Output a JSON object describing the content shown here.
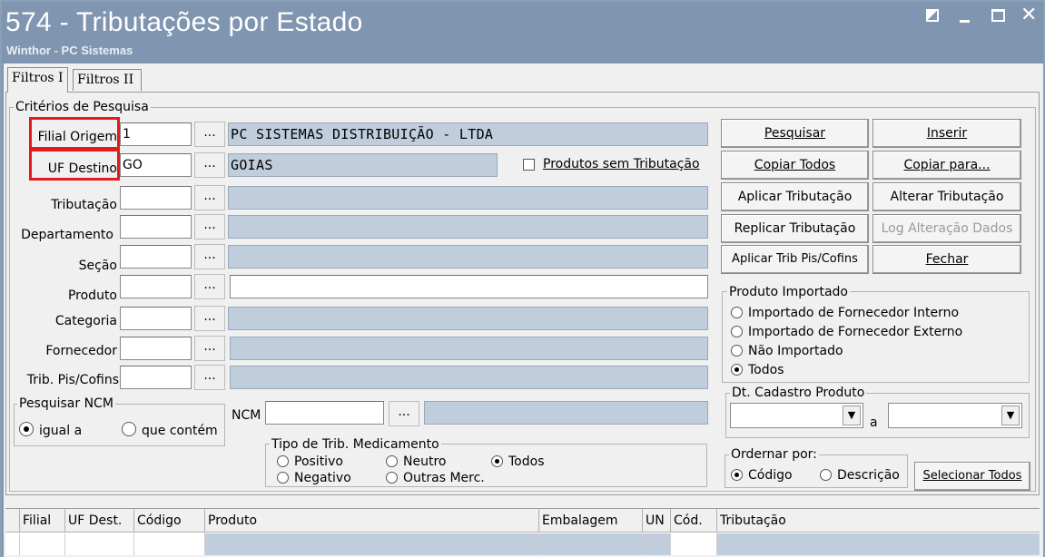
{
  "window": {
    "title": "574 - Tributações por Estado",
    "subtitle": "Winthor - PC Sistemas"
  },
  "tabs": [
    {
      "label": "Filtros I",
      "active": true
    },
    {
      "label": "Filtros II",
      "active": false
    }
  ],
  "criteria": {
    "legend": "Critérios de Pesquisa",
    "rows": [
      {
        "label": "Filial Origem",
        "value": "1",
        "description": "PC SISTEMAS DISTRIBUIÇÃO - LTDA"
      },
      {
        "label": "UF Destino",
        "value": "GO",
        "description": "GOIAS"
      },
      {
        "label": "Tributação",
        "value": "",
        "description": ""
      },
      {
        "label": "Departamento",
        "value": "",
        "description": ""
      },
      {
        "label": "Seção",
        "value": "",
        "description": ""
      },
      {
        "label": "Produto",
        "value": "",
        "description": ""
      },
      {
        "label": "Categoria",
        "value": "",
        "description": ""
      },
      {
        "label": "Fornecedor",
        "value": "",
        "description": ""
      },
      {
        "label": "Trib. Pis/Cofins",
        "value": "",
        "description": ""
      }
    ],
    "lookup_button": "...",
    "produtos_sem_tributacao": {
      "label": "Produtos sem Tributação",
      "checked": false
    }
  },
  "ncm_search": {
    "legend": "Pesquisar NCM",
    "options": [
      {
        "label": "igual a",
        "selected": true
      },
      {
        "label": "que contém",
        "selected": false
      }
    ],
    "ncm_label": "NCM",
    "ncm_value": ""
  },
  "tipo_trib_medicamento": {
    "legend": "Tipo de Trib. Medicamento",
    "options": [
      {
        "label": "Positivo",
        "selected": false
      },
      {
        "label": "Neutro",
        "selected": false
      },
      {
        "label": "Todos",
        "selected": true
      },
      {
        "label": "Negativo",
        "selected": false
      },
      {
        "label": "Outras Merc.",
        "selected": false
      }
    ]
  },
  "buttons": {
    "pesquisar": "Pesquisar",
    "inserir": "Inserir",
    "copiar_todos": "Copiar Todos",
    "copiar_para": "Copiar para...",
    "aplicar_tributacao": "Aplicar Tributação",
    "alterar_tributacao": "Alterar Tributação",
    "replicar_tributacao": "Replicar Tributação",
    "log_alteracao_dados": "Log Alteração Dados",
    "aplicar_trib_pis_cofins": "Aplicar Trib Pis/Cofins",
    "fechar": "Fechar",
    "selecionar_todos": "Selecionar Todos"
  },
  "produto_importado": {
    "legend": "Produto Importado",
    "options": [
      {
        "label": "Importado de Fornecedor Interno",
        "selected": false
      },
      {
        "label": "Importado de Fornecedor Externo",
        "selected": false
      },
      {
        "label": "Não Importado",
        "selected": false
      },
      {
        "label": "Todos",
        "selected": true
      }
    ]
  },
  "dt_cadastro": {
    "legend": "Dt. Cadastro Produto",
    "separator": "a",
    "from": "",
    "to": ""
  },
  "ordenar": {
    "legend": "Ordernar por:",
    "options": [
      {
        "label": "Código",
        "selected": true
      },
      {
        "label": "Descrição",
        "selected": false
      }
    ]
  },
  "grid": {
    "columns": [
      "Filial",
      "UF Dest.",
      "Código",
      "Produto",
      "Embalagem",
      "UN",
      "Cód.",
      "Tributação"
    ]
  },
  "colors": {
    "titlebar": "#8096b0",
    "readonly_field": "#bfcddc",
    "highlight_box": "#e01b1b"
  }
}
